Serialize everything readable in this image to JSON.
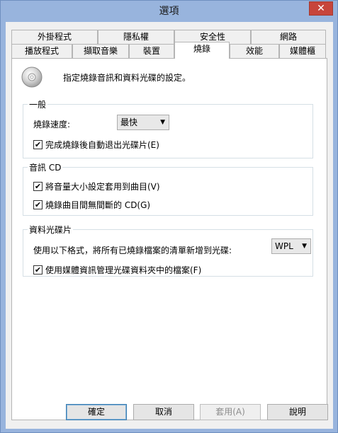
{
  "window": {
    "title": "選項",
    "close_glyph": "✕"
  },
  "tabs_row1": [
    {
      "label": "外掛程式"
    },
    {
      "label": "隱私權"
    },
    {
      "label": "安全性"
    },
    {
      "label": "網路"
    }
  ],
  "tabs_row2": [
    {
      "label": "播放程式"
    },
    {
      "label": "擷取音樂"
    },
    {
      "label": "裝置"
    },
    {
      "label": "燒錄",
      "active": true
    },
    {
      "label": "效能"
    },
    {
      "label": "媒體櫃"
    }
  ],
  "intro_text": "指定燒錄音訊和資料光碟的設定。",
  "general": {
    "title": "一般",
    "speed_label": "燒錄速度:",
    "speed_value": "最快",
    "eject_label": "完成燒錄後自動退出光碟片(E)",
    "eject_checked": true
  },
  "audio_cd": {
    "title": "音訊 CD",
    "volume_label": "將音量大小設定套用到曲目(V)",
    "volume_checked": true,
    "gapless_label": "燒錄曲目間無間斷的 CD(G)",
    "gapless_checked": true
  },
  "data_disc": {
    "title": "資料光碟片",
    "format_label": "使用以下格式，將所有已燒錄檔案的清單新增到光碟:",
    "format_value": "WPL",
    "media_info_label": "使用媒體資訊管理光碟資料夾中的檔案(F)",
    "media_info_checked": true
  },
  "buttons": {
    "ok": "確定",
    "cancel": "取消",
    "apply": "套用(A)",
    "help": "說明"
  },
  "checkmark_glyph": "✔",
  "dropdown_glyph": "▼"
}
